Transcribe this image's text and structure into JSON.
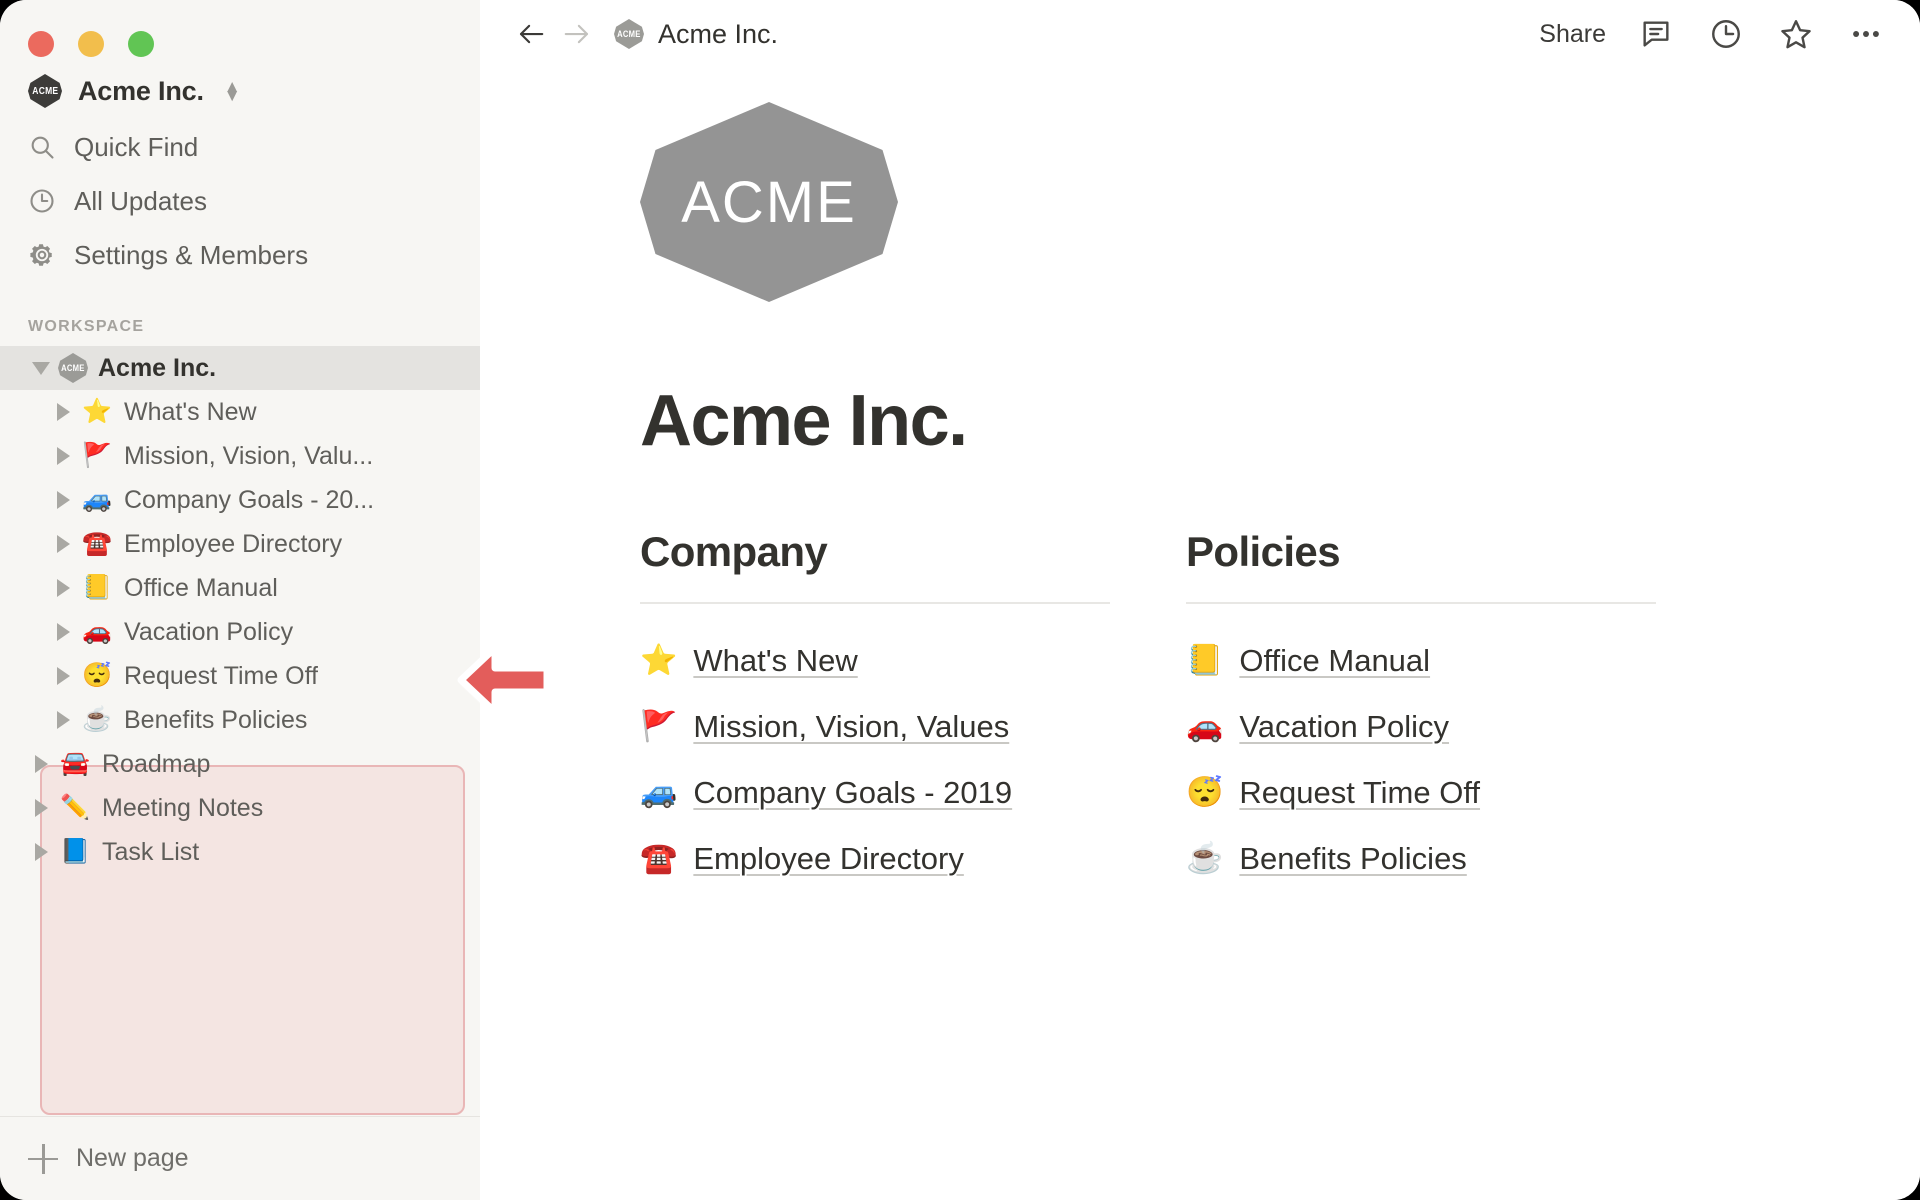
{
  "window": {
    "traffic_lights": [
      "close",
      "minimize",
      "maximize"
    ],
    "colors": {
      "red": "#EB6A5E",
      "yellow": "#F2BE4C",
      "green": "#61C554",
      "sidebar_bg": "#F7F6F3",
      "selected_row_bg": "#E4E3E0",
      "highlight_border": "#E9B6B6",
      "highlight_fill": "#FAEDED",
      "annotation_arrow": "#E35D5B",
      "logo_gray": "#949494"
    }
  },
  "sidebar": {
    "workspace_switcher": {
      "badge_text": "ACME",
      "name": "Acme Inc.",
      "chevron": "updown-chevron-icon"
    },
    "nav": [
      {
        "label": "Quick Find",
        "icon": "search-icon"
      },
      {
        "label": "All Updates",
        "icon": "clock-icon"
      },
      {
        "label": "Settings & Members",
        "icon": "gear-icon"
      }
    ],
    "section_label": "WORKSPACE",
    "root": {
      "label": "Acme Inc.",
      "badge_text": "ACME",
      "expanded": true,
      "selected": true
    },
    "children": [
      {
        "emoji": "⭐",
        "emoji_name": "star-emoji",
        "label": "What's New"
      },
      {
        "emoji": "🚩",
        "emoji_name": "triangular-flag-emoji",
        "label": "Mission, Vision, Valu..."
      },
      {
        "emoji": "🚙",
        "emoji_name": "blue-suv-emoji",
        "label": "Company Goals - 20..."
      },
      {
        "emoji": "☎️",
        "emoji_name": "telephone-emoji",
        "label": "Employee Directory"
      },
      {
        "emoji": "📒",
        "emoji_name": "ledger-emoji",
        "label": "Office Manual"
      },
      {
        "emoji": "🚗",
        "emoji_name": "red-car-side-emoji",
        "label": "Vacation Policy"
      },
      {
        "emoji": "😴",
        "emoji_name": "sleeping-face-emoji",
        "label": "Request Time Off"
      },
      {
        "emoji": "☕",
        "emoji_name": "hot-beverage-emoji",
        "label": "Benefits Policies"
      }
    ],
    "siblings": [
      {
        "emoji": "🚘",
        "emoji_name": "oncoming-car-emoji",
        "label": "Roadmap"
      },
      {
        "emoji": "✏️",
        "emoji_name": "pencil-emoji",
        "label": "Meeting Notes"
      },
      {
        "emoji": "📘",
        "emoji_name": "blue-book-emoji",
        "label": "Task List"
      }
    ],
    "footer": {
      "label": "New page",
      "icon": "plus-icon"
    }
  },
  "topbar": {
    "back": "back-arrow-icon",
    "forward": "forward-arrow-icon",
    "breadcrumb_badge": "ACME",
    "breadcrumb_title": "Acme Inc.",
    "share_label": "Share",
    "icons": [
      {
        "name": "comment-icon"
      },
      {
        "name": "updates-clock-icon"
      },
      {
        "name": "favorite-star-icon"
      },
      {
        "name": "more-options-icon"
      }
    ]
  },
  "page": {
    "logo_wordmark": "ACME",
    "title": "Acme Inc.",
    "columns": [
      {
        "heading": "Company",
        "links": [
          {
            "emoji": "⭐",
            "emoji_name": "star-emoji",
            "label": "What's New"
          },
          {
            "emoji": "🚩",
            "emoji_name": "triangular-flag-emoji",
            "label": "Mission, Vision, Values"
          },
          {
            "emoji": "🚙",
            "emoji_name": "blue-suv-emoji",
            "label": "Company Goals - 2019"
          },
          {
            "emoji": "☎️",
            "emoji_name": "telephone-emoji",
            "label": "Employee Directory"
          }
        ]
      },
      {
        "heading": "Policies",
        "links": [
          {
            "emoji": "📒",
            "emoji_name": "ledger-emoji",
            "label": "Office Manual"
          },
          {
            "emoji": "🚗",
            "emoji_name": "red-car-side-emoji",
            "label": "Vacation Policy"
          },
          {
            "emoji": "😴",
            "emoji_name": "sleeping-face-emoji",
            "label": "Request Time Off"
          },
          {
            "emoji": "☕",
            "emoji_name": "hot-beverage-emoji",
            "label": "Benefits Policies"
          }
        ]
      }
    ]
  },
  "annotation": {
    "arrow_direction": "left",
    "points_at": "sidebar-nested-pages-highlight"
  }
}
